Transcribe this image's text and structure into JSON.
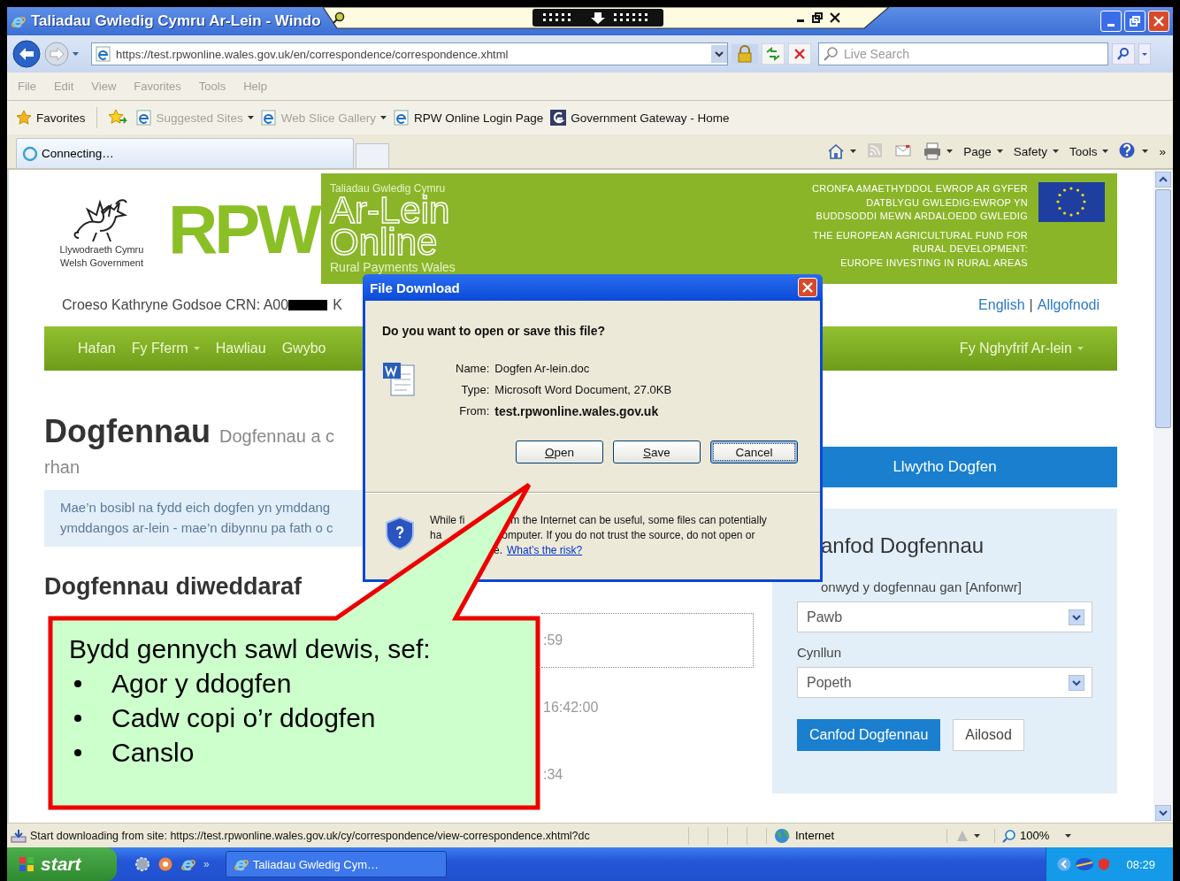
{
  "window": {
    "title": "Taliadau Gwledig Cymru Ar-Lein - Windo"
  },
  "address_bar": {
    "url": "https://test.rpwonline.wales.gov.uk/en/correspondence/correspondence.xhtml",
    "search_placeholder": "Live Search"
  },
  "menu": [
    {
      "label": "File",
      "disabled": true
    },
    {
      "label": "Edit",
      "disabled": true
    },
    {
      "label": "View",
      "disabled": true
    },
    {
      "label": "Favorites",
      "disabled": true
    },
    {
      "label": "Tools",
      "disabled": true
    },
    {
      "label": "Help",
      "disabled": true
    }
  ],
  "favorites_bar": {
    "label": "Favorites",
    "items": [
      {
        "label": "Suggested Sites",
        "kind": "page",
        "dropdown": true,
        "disabled": true
      },
      {
        "label": "Web Slice Gallery",
        "kind": "page",
        "dropdown": true,
        "disabled": true
      },
      {
        "label": "RPW Online Login Page",
        "kind": "page",
        "dropdown": false,
        "disabled": false
      },
      {
        "label": "Government Gateway - Home",
        "kind": "gateway",
        "dropdown": false,
        "disabled": false
      }
    ]
  },
  "tabs": [
    {
      "label": "Connecting…",
      "selected": true
    }
  ],
  "command_bar": [
    {
      "kind": "home",
      "dropdown": true,
      "disabled": false
    },
    {
      "kind": "feed",
      "dropdown": false,
      "disabled": true
    },
    {
      "kind": "mail",
      "dropdown": false,
      "disabled": false
    },
    {
      "kind": "print",
      "dropdown": true,
      "disabled": false
    },
    {
      "kind": "text",
      "label": "Page",
      "dropdown": true,
      "disabled": false
    },
    {
      "kind": "text",
      "label": "Safety",
      "dropdown": true,
      "disabled": false
    },
    {
      "kind": "text",
      "label": "Tools",
      "dropdown": true,
      "disabled": false
    },
    {
      "kind": "help",
      "dropdown": true,
      "disabled": false
    },
    {
      "kind": "text",
      "label": "»",
      "dropdown": false,
      "disabled": false
    }
  ],
  "page": {
    "header": {
      "logo_lines": [
        "Llywodraeth Cymru",
        "Welsh Government"
      ],
      "brand": "RPW",
      "band_small": "Taliadau Gwledig Cymru",
      "band_title": [
        "Ar-Lein",
        "Online"
      ],
      "band_sub": "Rural Payments Wales",
      "eu_text_cy": [
        "CRONFA AMAETHYDDOL EWROP AR GYFER",
        "DATBLYGU GWLEDIG:EWROP YN",
        "BUDDSODDI MEWN ARDALOEDD GWLEDIG"
      ],
      "eu_text_en": [
        "THE EUROPEAN AGRICULTURAL FUND FOR",
        "RURAL DEVELOPMENT:",
        "EUROPE INVESTING IN RURAL AREAS"
      ]
    },
    "welcome": {
      "text_before": "Croeso Kathryne Godsoe CRN: A00",
      "text_after": "K",
      "links": [
        "English",
        "Allgofnodi"
      ],
      "separator": "|"
    },
    "nav": [
      {
        "label": "Hafan",
        "dropdown": false
      },
      {
        "label": "Fy Fferm",
        "dropdown": true
      },
      {
        "label": "Hawliau",
        "dropdown": false
      },
      {
        "label": "Gwybo",
        "dropdown": false
      }
    ],
    "nav_right": {
      "label": "Fy Nghyfrif Ar-lein",
      "dropdown": true
    },
    "heading": "Dogfennau",
    "subheading": "Dogfennau a c",
    "subheading_cont": "rhan",
    "notice_lines": [
      "Mae’n bosibl na fydd eich dogfen yn ymddang",
      "ymddangos ar-lein - mae’n dibynnu pa fath o c"
    ],
    "recent_heading": "Dogfennau diweddaraf",
    "recent": [
      {
        "time": ":59",
        "highlighted": true
      },
      {
        "time": "16:42:00",
        "highlighted": false
      },
      {
        "time": ":34",
        "highlighted": false
      }
    ],
    "upload_button": "Llwytho Dogfen",
    "search_panel": {
      "title": "anfod Dogfennau",
      "fields": [
        {
          "label": "onwyd y dogfennau gan [Anfonwr]",
          "value": "Pawb"
        },
        {
          "label": "Cynllun",
          "value": "Popeth"
        }
      ],
      "buttons": [
        {
          "label": "Canfod Dogfennau",
          "primary": true
        },
        {
          "label": "Ailosod",
          "primary": false
        }
      ]
    }
  },
  "dialog": {
    "title": "File Download",
    "question": "Do you want to open or save this file?",
    "details": [
      {
        "label": "Name:",
        "value": "Dogfen Ar-lein.doc",
        "bold": false
      },
      {
        "label": "Type:",
        "value": "Microsoft Word Document, 27.0KB",
        "bold": false
      },
      {
        "label": "From:",
        "value": "test.rpwonline.wales.gov.uk",
        "bold": true
      }
    ],
    "buttons": [
      {
        "label": "Open",
        "access_key": true,
        "focused": false
      },
      {
        "label": "Save",
        "access_key": true,
        "focused": false
      },
      {
        "label": "Cancel",
        "access_key": false,
        "focused": true
      }
    ],
    "warning_lines": [
      [
        "While fi",
        "m the Internet can be useful, some files can potentially"
      ],
      [
        "ha",
        "omputer. If you do not trust the source, do not open or"
      ],
      [
        "e."
      ]
    ],
    "risk_link": "What’s the risk?"
  },
  "callout": {
    "intro": "Bydd gennych sawl dewis, sef:",
    "items": [
      "Agor y ddogfen",
      "Cadw copi o’r ddogfen",
      "Canslo"
    ]
  },
  "status_bar": {
    "text": "Start downloading from site: https://test.rpwonline.wales.gov.uk/cy/correspondence/view-correspondence.xhtml?dc",
    "zone": "Internet",
    "zoom": "100%"
  },
  "taskbar": {
    "start": "start",
    "more": "»",
    "tasks": [
      {
        "label": "Taliadau Gwledig Cym…",
        "selected": false
      }
    ],
    "clock": "08:29"
  }
}
